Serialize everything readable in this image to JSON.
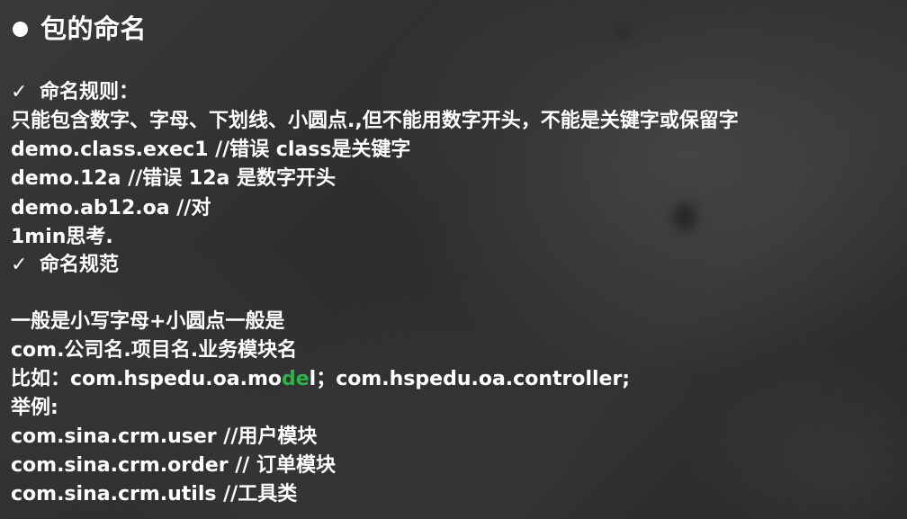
{
  "title": "包的命名",
  "sections": {
    "rules": {
      "heading": "命名规则：",
      "description": "只能包含数字、字母、下划线、小圆点.,但不能用数字开头，不能是关键字或保留字",
      "examples": [
        "demo.class.exec1  //错误 class是关键字",
        "demo.12a  //错误  12a 是数字开头",
        "demo.ab12.oa //对"
      ],
      "note": " 1min思考."
    },
    "conventions": {
      "heading": "命名规范",
      "line1": "一般是小写字母+小圆点一般是",
      "line2": "com.公司名.项目名.业务模块名",
      "example_prefix": "比如：com.hspedu.oa.mo",
      "example_highlight": "de",
      "example_suffix": "l；com.hspedu.oa.controller;",
      "examples_label": "举例:",
      "examples": [
        "com.sina.crm.user //用户模块",
        "com.sina.crm.order // 订单模块",
        "com.sina.crm.utils //工具类"
      ]
    }
  },
  "icons": {
    "title_bullet": "filled-circle-icon",
    "check": "✓"
  },
  "colors": {
    "background": "#2e2e2e",
    "text": "#ffffff",
    "highlight": "#2db34a"
  }
}
